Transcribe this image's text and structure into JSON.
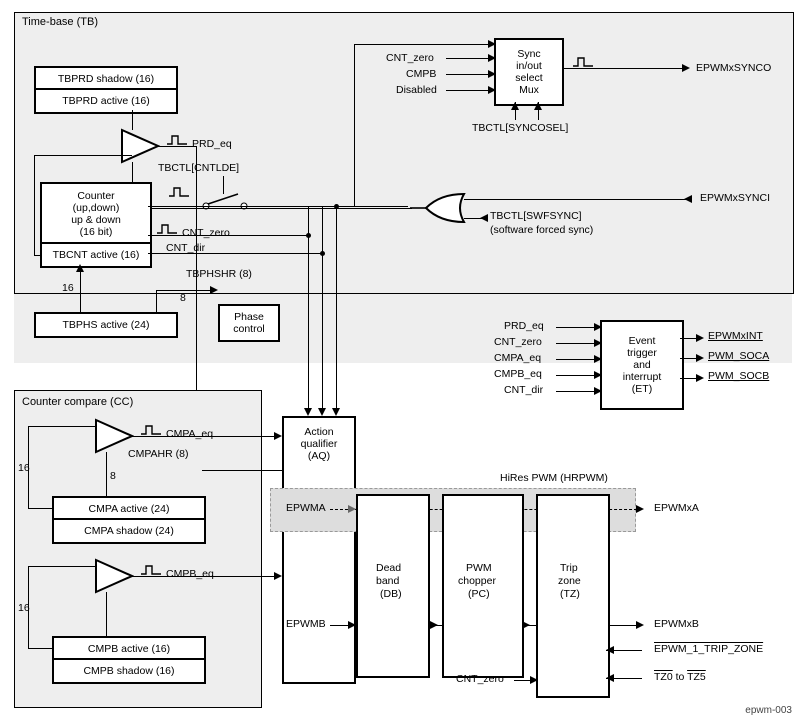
{
  "footer_id": "epwm-003",
  "modules": {
    "tb": {
      "title": "Time-base (TB)"
    },
    "cc": {
      "title": "Counter compare (CC)"
    }
  },
  "registers": {
    "tbprd_shadow": "TBPRD shadow (16)",
    "tbprd_active": "TBPRD active (16)",
    "tbcnt_active": "TBCNT active (16)",
    "tbphs_active": "TBPHS active (24)",
    "tbphshr": "TBPHSHR (8)",
    "cmpahr": "CMPAHR (8)",
    "cmpa_active": "CMPA active (24)",
    "cmpa_shadow": "CMPA shadow (24)",
    "cmpb_active": "CMPB active (16)",
    "cmpb_shadow": "CMPB shadow (16)"
  },
  "blocks": {
    "counter": {
      "l1": "Counter",
      "l2": "up,down",
      "l3": "up & down",
      "l4": "(16 bit)"
    },
    "phase_ctrl": {
      "l1": "Phase",
      "l2": "control"
    },
    "sync_mux": {
      "l1": "Sync",
      "l2": "in/out",
      "l3": "select",
      "l4": "Mux"
    },
    "aq": {
      "l1": "Action",
      "l2": "qualifier",
      "l3": "(AQ)"
    },
    "et": {
      "l1": "Event",
      "l2": "trigger",
      "l3": "and",
      "l4": "interrupt",
      "l5": "(ET)"
    },
    "db": {
      "l1": "Dead",
      "l2": "band",
      "l3": "(DB)"
    },
    "pc": {
      "l1": "PWM",
      "l2": "chopper",
      "l3": "(PC)"
    },
    "tz": {
      "l1": "Trip",
      "l2": "zone",
      "l3": "(TZ)"
    },
    "hrpwm": {
      "title": "HiRes PWM (HRPWM)"
    }
  },
  "signals": {
    "prd_eq": "PRD_eq",
    "tbctl_cntlde": "TBCTL[CNTLDE]",
    "cnt_zero": "CNT_zero",
    "cnt_dir": "CNT_dir",
    "cmpa_eq": "CMPA_eq",
    "cmpb_eq": "CMPB_eq",
    "tbctl_syncosel": "TBCTL[SYNCOSEL]",
    "tbctl_swfsync_l1": "TBCTL[SWFSYNC]",
    "tbctl_swfsync_l2": "(software forced sync)",
    "epwmx_synco": "EPWMxSYNCO",
    "epwmx_synci": "EPWMxSYNCI",
    "disabled": "Disabled",
    "cmpb": "CMPB",
    "prd_eq2": "PRD_eq",
    "cnt_zero2": "CNT_zero",
    "cmpa_eq2": "CMPA_eq",
    "cmpb_eq2": "CMPB_eq",
    "cnt_dir2": "CNT_dir",
    "epwmxint": "EPWMxINT",
    "pwm_soca": "PWM_SOCA",
    "pwm_socb": "PWM_SOCB",
    "epwma": "EPWMA",
    "epwmb": "EPWMB",
    "epwmxa": "EPWMxA",
    "epwmxb": "EPWMxB",
    "epwm1_tripzone": "EPWM_1_TRIP_ZONE",
    "tz0": "TZ0",
    "tz5": "TZ5",
    "to": " to ",
    "cnt_zero3": "CNT_zero",
    "w16": "16",
    "w8": "8"
  }
}
